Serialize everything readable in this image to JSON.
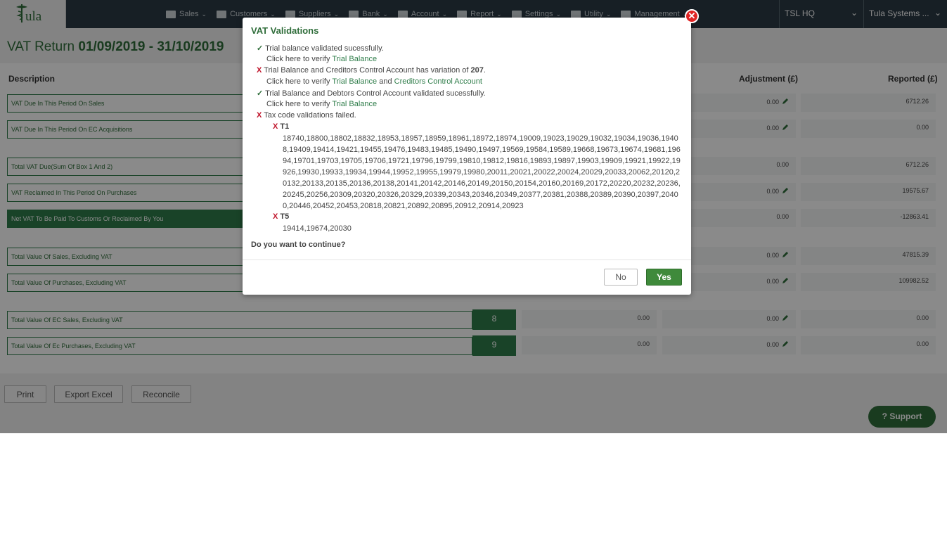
{
  "app": {
    "logo_text": "ula"
  },
  "nav": {
    "items": [
      {
        "label": "Sales",
        "icon": "cart-icon"
      },
      {
        "label": "Customers",
        "icon": "money-icon"
      },
      {
        "label": "Suppliers",
        "icon": "list-icon"
      },
      {
        "label": "Bank",
        "icon": "bank-icon"
      },
      {
        "label": "Account",
        "icon": "book-icon"
      },
      {
        "label": "Report",
        "icon": "chart-icon"
      },
      {
        "label": "Settings",
        "icon": "gear-icon"
      },
      {
        "label": "Utility",
        "icon": "wrench-icon"
      },
      {
        "label": "Management",
        "icon": "user-icon"
      }
    ],
    "org_1": "TSL HQ",
    "org_2": "Tula Systems ..."
  },
  "page": {
    "title_prefix": "VAT Return",
    "title_dates": "01/09/2019 - 31/10/2019",
    "col_description": "Description",
    "col_adjustment": "Adjustment (£)",
    "col_reported": "Reported (£)"
  },
  "rows": [
    {
      "desc": "VAT Due In This Period On Sales",
      "adj": "0.00",
      "rep": "6712.26"
    },
    {
      "desc": "VAT Due In This Period On EC Acquisitions",
      "adj": "0.00",
      "rep": "0.00"
    },
    {
      "desc": "Total VAT Due(Sum Of Box 1 And 2)",
      "adj": "0.00",
      "rep": "6712.26"
    },
    {
      "desc": "VAT Reclaimed In This Period On Purchases",
      "adj": "0.00",
      "rep": "19575.67"
    },
    {
      "desc": "Net VAT To Be Paid To Customs Or Reclaimed By You",
      "adj": "0.00",
      "rep": "-12863.41"
    },
    {
      "desc": "Total Value Of Sales, Excluding VAT",
      "adj": "0.00",
      "rep": "47815.39"
    },
    {
      "desc": "Total Value Of Purchases, Excluding VAT",
      "adj": "0.00",
      "rep": "109982.52"
    },
    {
      "desc": "Total Value Of EC Sales, Excluding VAT",
      "box": "8",
      "val": "0.00",
      "adj": "0.00",
      "rep": "0.00"
    },
    {
      "desc": "Total Value Of Ec Purchases, Excluding VAT",
      "box": "9",
      "val": "0.00",
      "adj": "0.00",
      "rep": "0.00"
    }
  ],
  "buttons": {
    "print": "Print",
    "export": "Export Excel",
    "reconcile": "Reconcile",
    "support": "? Support"
  },
  "modal": {
    "title": "VAT Validations",
    "close": "✕",
    "check_mark": "✓",
    "fail_mark": "X",
    "l1": "Trial balance validated sucessfully.",
    "click_verify": "Click here to verify",
    "link_tb": "Trial Balance",
    "and": "and",
    "link_cca": "Creditors Control Account",
    "l2_prefix": "Trial Balance and Creditors Control Account has variation of",
    "l2_amount": "207",
    "l2_suffix": ".",
    "l3": "Trial Balance and Debtors Control Account validated sucessfully.",
    "l4": "Tax code validations failed.",
    "t1_code": "T1",
    "t1_list": "18740,18800,18802,18832,18953,18957,18959,18961,18972,18974,19009,19023,19029,19032,19034,19036,19408,19409,19414,19421,19455,19476,19483,19485,19490,19497,19569,19584,19589,19668,19673,19674,19681,19694,19701,19703,19705,19706,19721,19796,19799,19810,19812,19816,19893,19897,19903,19909,19921,19922,19926,19930,19933,19934,19944,19952,19955,19979,19980,20011,20021,20022,20024,20029,20033,20062,20120,20132,20133,20135,20136,20138,20141,20142,20146,20149,20150,20154,20160,20169,20172,20220,20232,20236,20245,20256,20309,20320,20326,20329,20339,20343,20346,20349,20377,20381,20388,20389,20390,20397,20400,20446,20452,20453,20818,20821,20892,20895,20912,20914,20923",
    "t5_code": "T5",
    "t5_list": "19414,19674,20030",
    "question": "Do you want to continue?",
    "no": "No",
    "yes": "Yes"
  }
}
